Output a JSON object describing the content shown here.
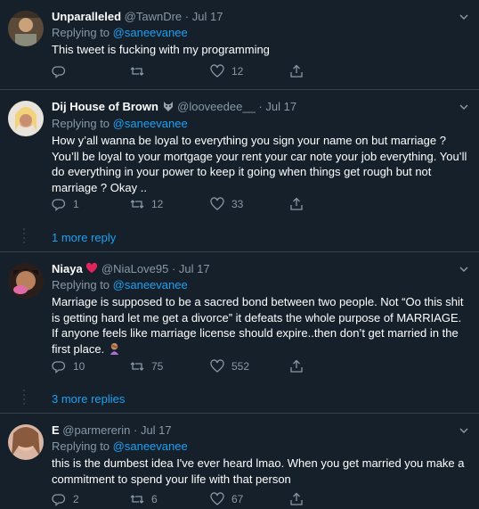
{
  "tweets": [
    {
      "name": "Unparalleled",
      "handle": "@TawnDre",
      "sep": "·",
      "time": "Jul 17",
      "reply_prefix": "Replying to",
      "reply_to": "@saneevanee",
      "text": "This tweet is fucking with my programming",
      "replies": "",
      "retweets": "",
      "likes": "12"
    },
    {
      "name": "Dij House of Brown",
      "name_icon": "wolf-emoji-icon",
      "handle": "@looveedee__",
      "sep": "·",
      "time": "Jul 17",
      "reply_prefix": "Replying to",
      "reply_to": "@saneevanee",
      "text": "How y’all wanna be loyal to everything you sign your name on but marriage ? You’ll be loyal to your mortgage your rent your car note your job everything. You’ll do everything in your power to keep it going when things get rough but not marriage ? Okay ..",
      "replies": "1",
      "retweets": "12",
      "likes": "33",
      "more_replies": "1 more reply"
    },
    {
      "name": "Niaya",
      "name_icon": "heart-emoji-icon",
      "handle": "@NiaLove95",
      "sep": "·",
      "time": "Jul 17",
      "reply_prefix": "Replying to",
      "reply_to": "@saneevanee",
      "text": "Marriage is supposed to be a sacred bond between two people. Not “Oo this shit is getting hard let me get a divorce” it defeats the whole purpose of MARRIAGE. If anyone feels like marriage license should expire..then don’t get married in the first place.",
      "text_icon": "woman-facepalming-emoji-icon",
      "replies": "10",
      "retweets": "75",
      "likes": "552",
      "more_replies": "3 more replies"
    },
    {
      "name": "E",
      "handle": "@parmererin",
      "sep": "·",
      "time": "Jul 17",
      "reply_prefix": "Replying to",
      "reply_to": "@saneevanee",
      "text": "this is the dumbest idea I've ever heard lmao. When you get married you make a commitment to spend your life with that person",
      "replies": "2",
      "retweets": "6",
      "likes": "67"
    }
  ],
  "colors": {
    "background": "#15202b",
    "divider": "#38444d",
    "secondary_text": "#8899a6",
    "link": "#1da1f2"
  }
}
